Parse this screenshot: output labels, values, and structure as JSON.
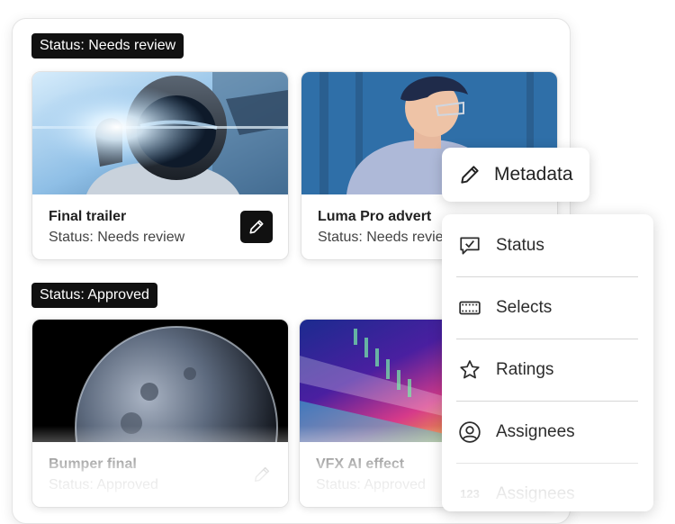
{
  "groups": [
    {
      "badge": "Status: Needs review"
    },
    {
      "badge": "Status: Approved"
    }
  ],
  "cards": [
    {
      "title": "Final trailer",
      "status": "Status: Needs review"
    },
    {
      "title": "Luma Pro advert",
      "status": "Status: Needs review"
    },
    {
      "title": "Bumper final",
      "status": "Status: Approved"
    },
    {
      "title": "VFX AI effect",
      "status": "Status: Approved"
    }
  ],
  "metadata_button": {
    "label": "Metadata",
    "icon": "pencil-icon"
  },
  "menu": {
    "items": [
      {
        "label": "Status",
        "icon": "chat-check-icon"
      },
      {
        "label": "Selects",
        "icon": "film-strip-icon"
      },
      {
        "label": "Ratings",
        "icon": "star-icon"
      },
      {
        "label": "Assignees",
        "icon": "user-circle-icon"
      },
      {
        "label": "Assignees",
        "icon": "number-icon",
        "icon_text": "123"
      }
    ]
  },
  "colors": {
    "badge_bg": "#111111",
    "accent": "#111111"
  }
}
